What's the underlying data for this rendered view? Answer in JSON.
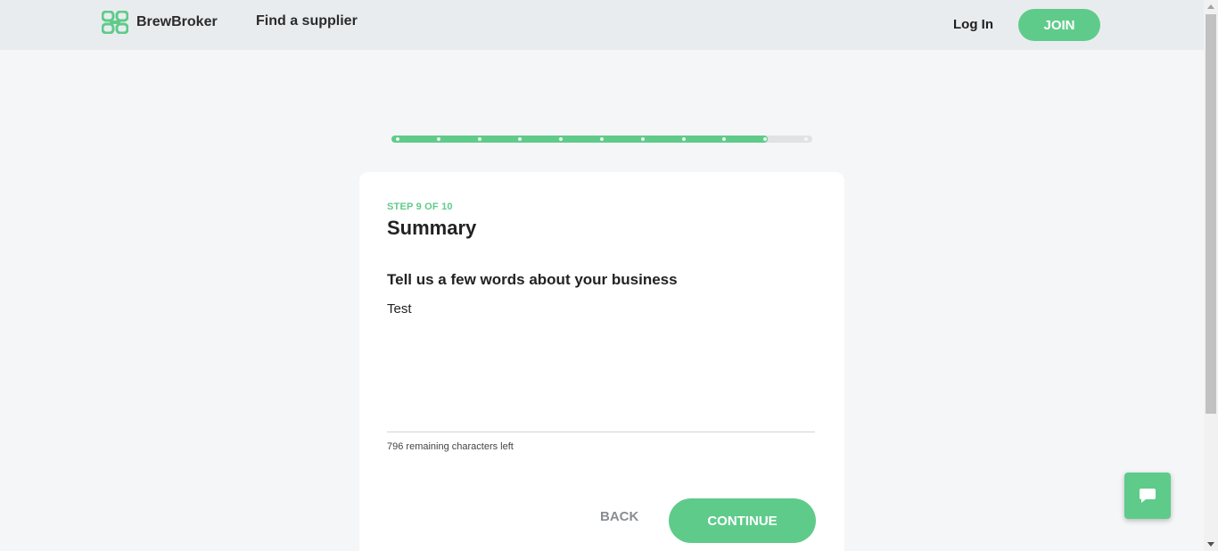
{
  "header": {
    "brand": "BrewBroker",
    "nav_find": "Find a supplier",
    "login": "Log In",
    "join": "JOIN"
  },
  "progress": {
    "current_step": 9,
    "total_steps": 10
  },
  "card": {
    "step_label": "STEP 9 OF 10",
    "title": "Summary",
    "question": "Tell us a few words about your business",
    "answer_value": "Test",
    "counter": "796 remaining characters left",
    "back_label": "BACK",
    "continue_label": "CONTINUE"
  },
  "icons": {
    "logo": "brewbroker-logo-icon",
    "chat": "chat-icon"
  },
  "colors": {
    "accent": "#5fcb8a",
    "header_bg": "#e9ecef",
    "page_bg": "#f5f6f7"
  }
}
